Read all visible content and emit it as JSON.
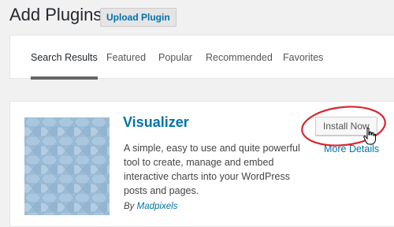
{
  "header": {
    "title": "Add Plugins",
    "upload_label": "Upload Plugin"
  },
  "tabs": [
    {
      "label": "Search Results",
      "active": true
    },
    {
      "label": "Featured",
      "active": false
    },
    {
      "label": "Popular",
      "active": false
    },
    {
      "label": "Recommended",
      "active": false
    },
    {
      "label": "Favorites",
      "active": false
    }
  ],
  "plugin": {
    "name": "Visualizer",
    "description": "A simple, easy to use and quite powerful tool to create, manage and embed interactive charts into your WordPress posts and pages.",
    "author_prefix": "By",
    "author": "Madpixels",
    "install_label": "Install Now",
    "details_label": "More Details",
    "thumbnail_icon": "hexagon-pattern-icon"
  },
  "colors": {
    "link": "#0073aa",
    "highlight": "#d9262e",
    "thumbnail": "#9cbcd6"
  }
}
